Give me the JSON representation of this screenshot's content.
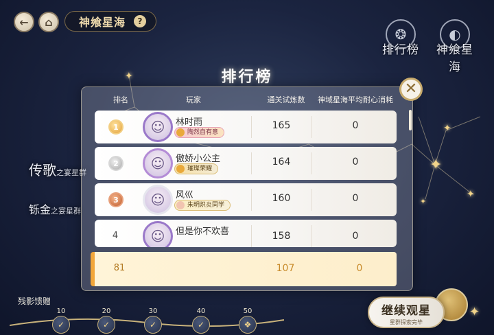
{
  "topbar": {
    "back_icon": "back-arrow-icon",
    "home_icon": "home-icon",
    "title": "神飨星海",
    "help": "?"
  },
  "side_tabs": [
    {
      "label": "排行榜",
      "icon": "ranking-emblem-icon"
    },
    {
      "label": "神飨星海",
      "icon": "galaxy-emblem-icon"
    }
  ],
  "left_labels": [
    {
      "big": "传歌",
      "small": "之宴星群"
    },
    {
      "big": "铄金",
      "small": "之宴星群"
    }
  ],
  "leaderboard": {
    "title": "排行榜",
    "close_icon": "close-icon",
    "columns": [
      "排名",
      "玩家",
      "通关试炼数",
      "神域星海平均耐心消耗"
    ],
    "rows": [
      {
        "rank": "1",
        "medal": "gold",
        "name": "林时雨",
        "badge": "陶然自有意",
        "cleared": "165",
        "patience": "0"
      },
      {
        "rank": "2",
        "medal": "silver",
        "name": "傲娇小公主",
        "badge": "璀璨荣耀",
        "cleared": "164",
        "patience": "0"
      },
      {
        "rank": "3",
        "medal": "bronze",
        "name": "风巛",
        "badge": "朱明炽炎同学",
        "cleared": "160",
        "patience": "0"
      },
      {
        "rank": "4",
        "medal": "",
        "name": "但是你不欢喜",
        "badge": "",
        "cleared": "158",
        "patience": "0"
      }
    ],
    "self_row": {
      "rank": "81",
      "cleared": "107",
      "patience": "0"
    }
  },
  "rewards": {
    "label": "残影馈赠",
    "nodes": [
      {
        "num": "10",
        "icon": "gift-icon",
        "checked": true
      },
      {
        "num": "20",
        "icon": "gift-icon",
        "checked": true
      },
      {
        "num": "30",
        "icon": "gift-icon",
        "checked": true
      },
      {
        "num": "40",
        "icon": "gift-icon",
        "checked": true
      },
      {
        "num": "50",
        "icon": "gift-icon",
        "checked": false
      }
    ]
  },
  "continue_button": {
    "main": "继续观星",
    "sub": "星群探索完毕"
  },
  "colors": {
    "accent_gold": "#f2a63a",
    "panel_border": "#c7aa6c"
  }
}
